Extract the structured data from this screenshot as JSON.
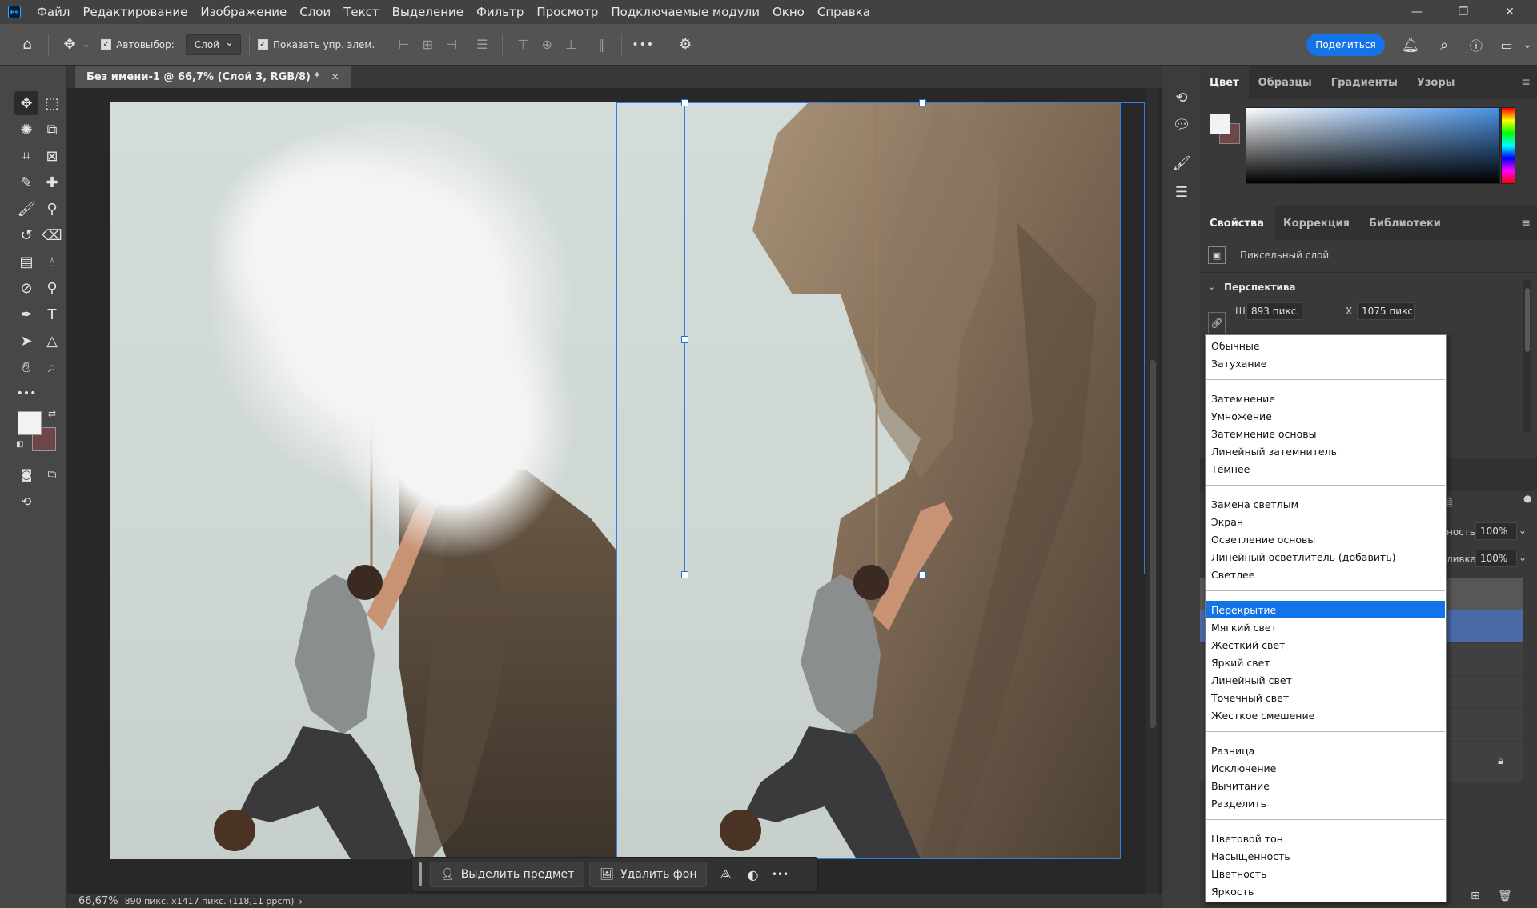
{
  "menu": {
    "logo": "Ps",
    "items": [
      "Файл",
      "Редактирование",
      "Изображение",
      "Слои",
      "Текст",
      "Выделение",
      "Фильтр",
      "Просмотр",
      "Подключаемые модули",
      "Окно",
      "Справка"
    ]
  },
  "window_controls": {
    "minimize": "—",
    "restore": "❐",
    "close": "✕"
  },
  "options_bar": {
    "autoselect_label": "Автовыбор:",
    "autoselect_value": "Слой",
    "show_controls_label": "Показать упр. элем.",
    "share_label": "Поделиться"
  },
  "document": {
    "tab_title": "Без имени-1 @ 66,7% (Слой 3, RGB/8) *",
    "close": "×"
  },
  "color_panel": {
    "tabs": [
      "Цвет",
      "Образцы",
      "Градиенты",
      "Узоры"
    ],
    "foreground": "#f2f2f2",
    "background": "#6e4646"
  },
  "properties_panel": {
    "tabs": [
      "Свойства",
      "Коррекция",
      "Библиотеки"
    ],
    "layer_type": "Пиксельный слой",
    "section": "Перспектива",
    "w_label": "Ш",
    "w_value": "893 пикс.",
    "x_label": "X",
    "x_value": "1075 пикс"
  },
  "layers_panel": {
    "opacity_label": "ность:",
    "opacity_value": "100%",
    "fill_label": "ливка:",
    "fill_value": "100%"
  },
  "blend_modes": {
    "groups": [
      [
        "Обычные",
        "Затухание"
      ],
      [
        "Затемнение",
        "Умножение",
        "Затемнение основы",
        "Линейный затемнитель",
        "Темнее"
      ],
      [
        "Замена светлым",
        "Экран",
        "Осветление основы",
        "Линейный осветлитель (добавить)",
        "Светлее"
      ],
      [
        "Перекрытие",
        "Мягкий свет",
        "Жесткий свет",
        "Яркий свет",
        "Линейный свет",
        "Точечный свет",
        "Жесткое смешение"
      ],
      [
        "Разница",
        "Исключение",
        "Вычитание",
        "Разделить"
      ],
      [
        "Цветовой тон",
        "Насыщенность",
        "Цветность",
        "Яркость"
      ]
    ],
    "selected": "Перекрытие"
  },
  "taskbar": {
    "select_subject": "Выделить предмет",
    "remove_bg": "Удалить фон",
    "more": "•••"
  },
  "status": {
    "zoom": "66,67%",
    "dimensions": "890 пикс. x1417 пикс. (118,11 ppcm)"
  }
}
